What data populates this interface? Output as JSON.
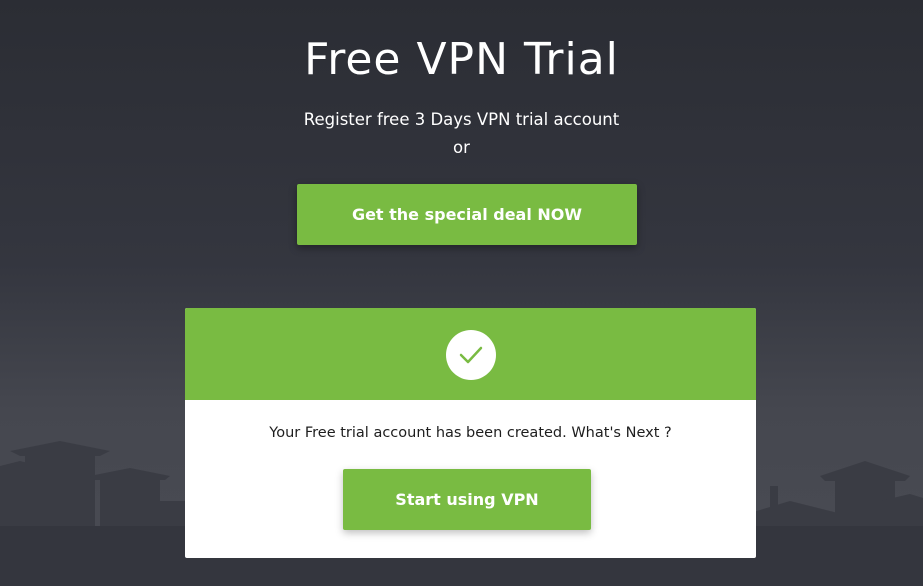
{
  "hero": {
    "title": "Free VPN Trial",
    "subtitle": "Register free 3 Days VPN trial account",
    "or_text": "or",
    "deal_button_label": "Get the special deal NOW"
  },
  "confirmation_card": {
    "icon": "checkmark-icon",
    "message": "Your Free trial account has been created. What's Next ?",
    "start_button_label": "Start using VPN"
  },
  "colors": {
    "accent_green": "#79bb42",
    "background_dark": "#2b2d34",
    "card_background": "#ffffff",
    "text_dark": "#1e1e1e"
  }
}
